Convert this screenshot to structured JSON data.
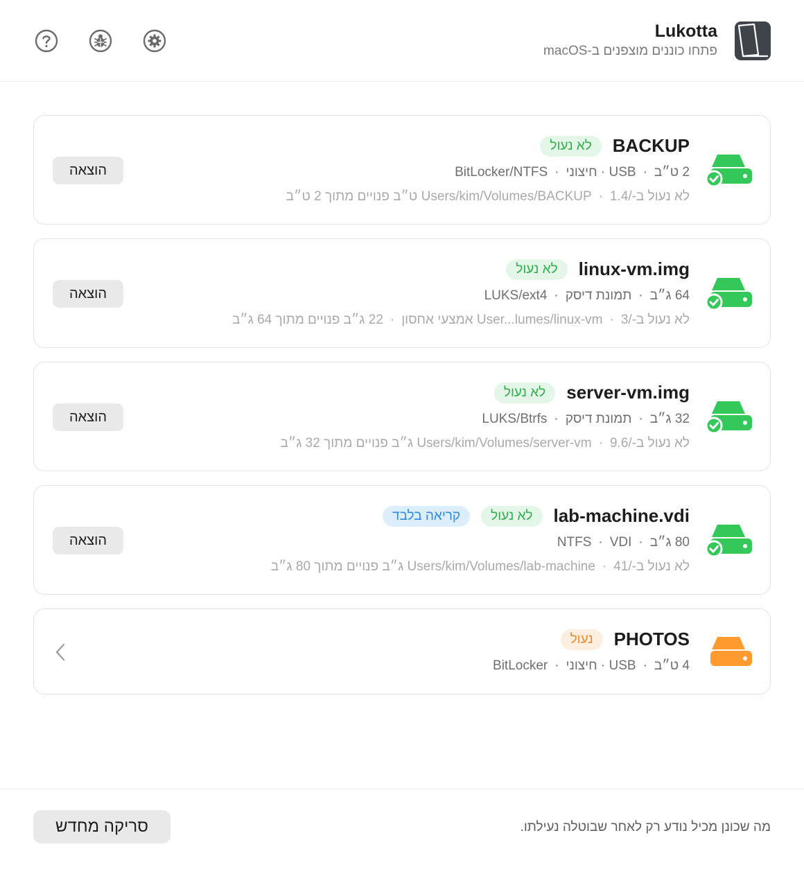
{
  "header": {
    "app_name": "Lukotta",
    "subtitle": "פתחו כוננים מוצפנים ב-macOS",
    "icons": [
      "help-icon",
      "bug-icon",
      "gear-icon"
    ]
  },
  "colors": {
    "green": "#34c759",
    "orange": "#ff9a2e",
    "blue": "#2b8be6"
  },
  "volumes": [
    {
      "name": "BACKUP",
      "badges": [
        "לא נעול"
      ],
      "meta": [
        "2 ט״ב",
        "USB · חיצוני",
        "BitLocker/NTFS"
      ],
      "details": [
        "לא נעול ב-/Users/kim/Volumes/BACKUP",
        "1.4 ט״ב פנויים מתוך 2 ט״ב"
      ],
      "action": "הוצאה",
      "status": "unlocked"
    },
    {
      "name": "linux-vm.img",
      "badges": [
        "לא נעול"
      ],
      "meta": [
        "64 ג״ב",
        "תמונת דיסק",
        "LUKS/ext4"
      ],
      "details": [
        "לא נעול ב-/User...lumes/linux-vm",
        "3 אמצעי אחסון",
        "22 ג״ב פנויים מתוך 64 ג״ב"
      ],
      "action": "הוצאה",
      "status": "unlocked"
    },
    {
      "name": "server-vm.img",
      "badges": [
        "לא נעול"
      ],
      "meta": [
        "32 ג״ב",
        "תמונת דיסק",
        "LUKS/Btrfs"
      ],
      "details": [
        "לא נעול ב-/Users/kim/Volumes/server-vm",
        "9.6 ג״ב פנויים מתוך 32 ג״ב"
      ],
      "action": "הוצאה",
      "status": "unlocked"
    },
    {
      "name": "lab-machine.vdi",
      "badges": [
        "לא נעול",
        "קריאה בלבד"
      ],
      "meta": [
        "80 ג״ב",
        "NTFS",
        "VDI"
      ],
      "details": [
        "לא נעול ב-/Users/kim/Volumes/lab-machine",
        "41 ג״ב פנויים מתוך 80 ג״ב"
      ],
      "action": "הוצאה",
      "status": "unlocked"
    },
    {
      "name": "PHOTOS",
      "badges": [
        "נעול"
      ],
      "meta": [
        "4 ט״ב",
        "USB · חיצוני",
        "BitLocker"
      ],
      "details": [],
      "status": "locked"
    }
  ],
  "footer": {
    "note": "מה שכונן מכיל נודע רק לאחר שבוטלה נעילתו.",
    "rescan_label": "סריקה מחדש"
  }
}
